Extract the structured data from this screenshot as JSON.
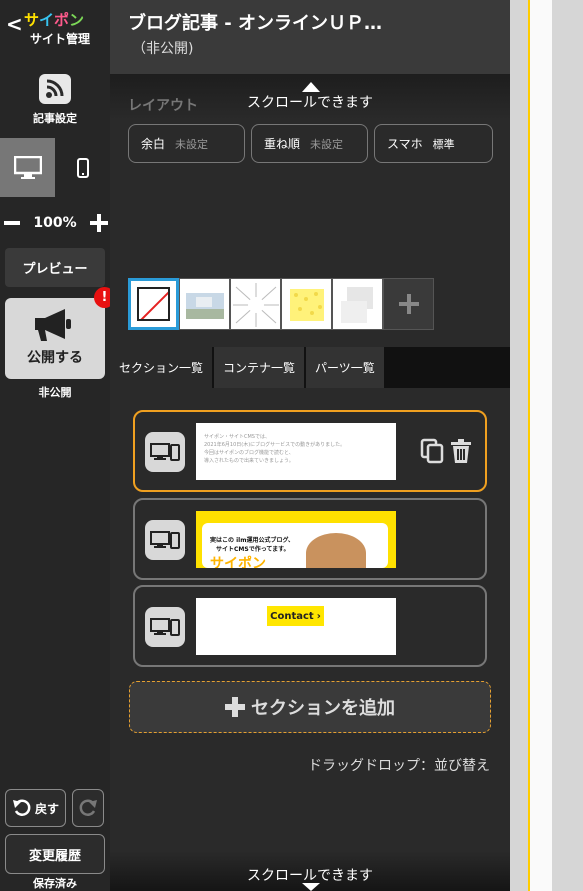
{
  "brand": {
    "logo_parts": [
      "サ",
      "イ",
      "ポ",
      "ン"
    ],
    "subtitle": "サイト管理"
  },
  "sidebar": {
    "article_settings": "記事設定",
    "zoom": "100%",
    "preview": "プレビュー",
    "publish": "公開する",
    "publish_badge": "!",
    "publish_status": "非公開",
    "undo": "戻す",
    "history": "変更履歴",
    "saved": "保存済み"
  },
  "header": {
    "title": "ブログ記事 - オンラインＵＰ…",
    "status": "（非公開)"
  },
  "scroll_hint": "スクロールできます",
  "layout": {
    "label": "レイアウト",
    "margin_label": "余白",
    "margin_value": "未設定",
    "overlap_label": "重ね順",
    "overlap_value": "未設定",
    "mobile_label": "スマホ",
    "mobile_value": "標準"
  },
  "tabs": [
    "セクション一覧",
    "コンテナ一覧",
    "パーツ一覧"
  ],
  "sections": {
    "card1_lines": [
      "サイポン・サイトCMSでは、",
      "2021年6月10日(木)にブログサービスでの動きがありました。",
      "今回はサイポンのブログ機能で読むと、",
      "導入されたもので出来ていきましょう。"
    ],
    "card2_line1": "実はこの ilm運用公式ブログ、",
    "card2_line2": "サイトCMSで作ってます。",
    "card2_big": "サイポン",
    "card3_contact": "Contact",
    "add": "セクションを追加",
    "drag_hint": "ドラッグドロップ：並び替え"
  },
  "colors": {
    "accent": "#f0a020",
    "selected": "#2a9bd8",
    "badge": "#e81010",
    "logo_yellow": "#ffe100",
    "logo_blue": "#37c3f0",
    "logo_pink": "#ff5a8c",
    "logo_green": "#7cd857"
  },
  "icons": [
    "chevron-left-icon",
    "rss-icon",
    "desktop-icon",
    "mobile-icon",
    "minus-icon",
    "plus-icon",
    "megaphone-icon",
    "undo-icon",
    "redo-icon",
    "copy-icon",
    "trash-icon"
  ]
}
